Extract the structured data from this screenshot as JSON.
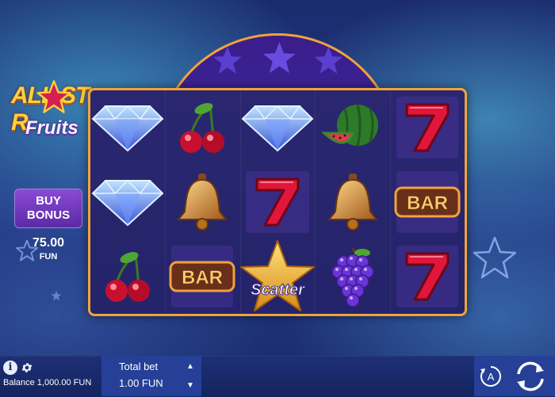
{
  "game": {
    "logo_line1": "ALL ST R",
    "logo_line2": "Fruits",
    "logo_alt": "All Star Fruits"
  },
  "bonus": {
    "button_line1": "BUY",
    "button_line2": "BONUS",
    "price": "75.00",
    "currency": "FUN"
  },
  "reels": [
    [
      "diamond",
      "cherry",
      "diamond",
      "watermelon",
      "seven"
    ],
    [
      "diamond",
      "bell",
      "seven",
      "bell",
      "bar"
    ],
    [
      "cherry",
      "bar",
      "scatter",
      "grapes",
      "seven"
    ]
  ],
  "symbol_labels": {
    "bar": "BAR",
    "scatter": "Scatter"
  },
  "bottom_bar": {
    "info_icon": "i",
    "balance": "Balance 1,000.00 FUN",
    "bet_title": "Total bet",
    "bet_value": "1.00 FUN",
    "bet_up": "▲",
    "bet_down": "▼",
    "autoplay_letter": "A"
  },
  "colors": {
    "frame": "#f1a33b",
    "accent_purple": "#7a3fd0",
    "star_gold": "#f4c542"
  }
}
